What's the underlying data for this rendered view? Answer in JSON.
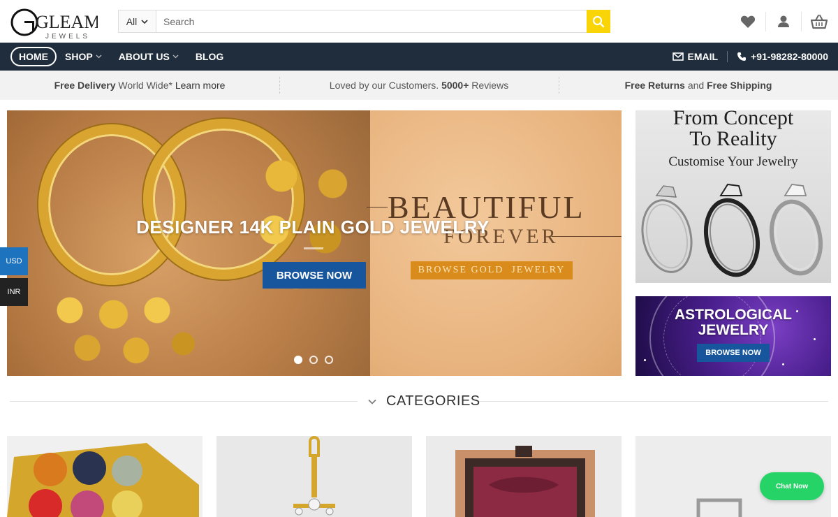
{
  "header": {
    "logo_main": "GLEAM",
    "logo_sub": "JEWELS",
    "search_category": "All",
    "search_placeholder": "Search",
    "icons": [
      "heart-icon",
      "user-icon",
      "basket-icon"
    ]
  },
  "nav": {
    "items": [
      {
        "label": "HOME",
        "active": true
      },
      {
        "label": "SHOP",
        "has_dropdown": true
      },
      {
        "label": "ABOUT US",
        "has_dropdown": true
      },
      {
        "label": "BLOG"
      }
    ],
    "email_label": "EMAIL",
    "phone": "+91-98282-80000"
  },
  "infobar": {
    "delivery_bold": "Free Delivery",
    "delivery_mid": " World Wide* ",
    "delivery_link": "Learn more",
    "reviews_text": "Loved by our Customers. ",
    "reviews_bold": "5000+",
    "reviews_tail": " Reviews",
    "returns_bold": "Free Returns",
    "returns_mid": " and ",
    "returns_bold2": "Free Shipping"
  },
  "hero": {
    "title": "DESIGNER 14K PLAIN GOLD JEWELRY",
    "button": "BROWSE NOW",
    "image_text_1": "BEAUTIFUL",
    "image_text_2": "FOREVER",
    "image_button": "BROWSE GOLD  JEWELRY",
    "slides": 3,
    "active_slide": 1
  },
  "currency": {
    "usd": "USD",
    "inr": "INR"
  },
  "promo1": {
    "title_line1": "From Concept",
    "title_line2": "To Reality",
    "subtitle": "Customise Your Jewelry"
  },
  "promo2": {
    "title_line1": "ASTROLOGICAL",
    "title_line2": "JEWELRY",
    "button": "BROWSE NOW"
  },
  "categories": {
    "title": "CATEGORIES",
    "count_visible": 4
  },
  "chat": {
    "label": "Chat Now"
  },
  "colors": {
    "nav_bg": "#1f2d3d",
    "accent_yellow": "#f9d406",
    "button_blue": "#17569c",
    "chat_green": "#25d366",
    "usd_blue": "#1e73be"
  }
}
